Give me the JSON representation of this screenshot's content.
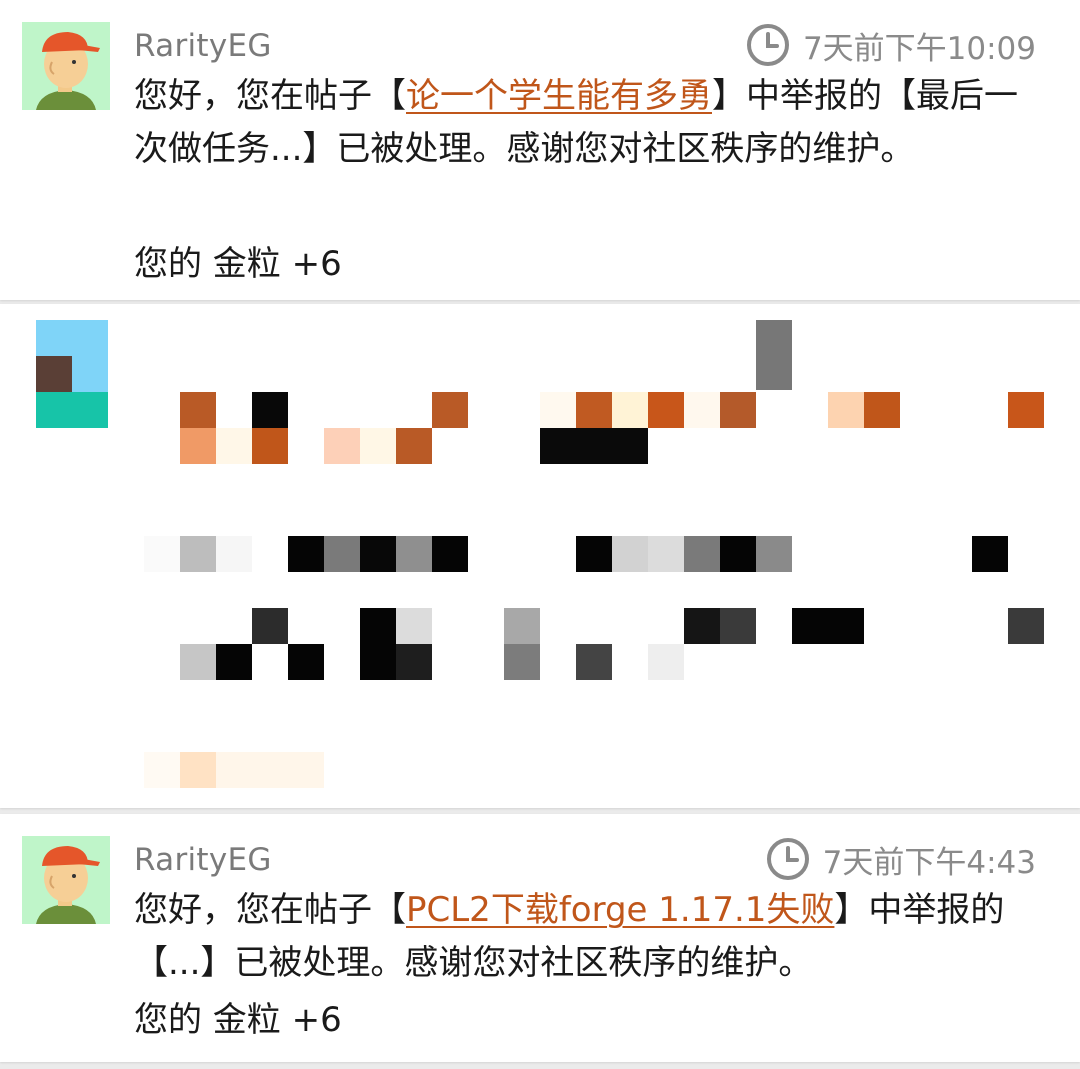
{
  "notifications": [
    {
      "author": "RarityEG",
      "time": "7天前下午10:09",
      "prefix": "您好，您在帖子【",
      "thread_title": "论一个学生能有多勇",
      "suffix": "】中举报的【最后一次做任务...】已被处理。感谢您对社区秩序的维护。",
      "reward": "您的 金粒 +6"
    },
    {
      "author": "RarityEG",
      "time": "7天前下午4:43",
      "prefix": "您好，您在帖子【",
      "thread_title": "PCL2下载forge 1.17.1失败",
      "suffix": "】中举报的【...】已被处理。感谢您对社区秩序的维护。",
      "reward": "您的 金粒 +6"
    }
  ],
  "icons": {
    "clock": "clock-icon",
    "avatar": "cartoon-avatar-orange-cap"
  },
  "colors": {
    "link": "#c0561a",
    "meta_text": "#7a7a7a",
    "avatar_bg": "#bff5c9"
  }
}
